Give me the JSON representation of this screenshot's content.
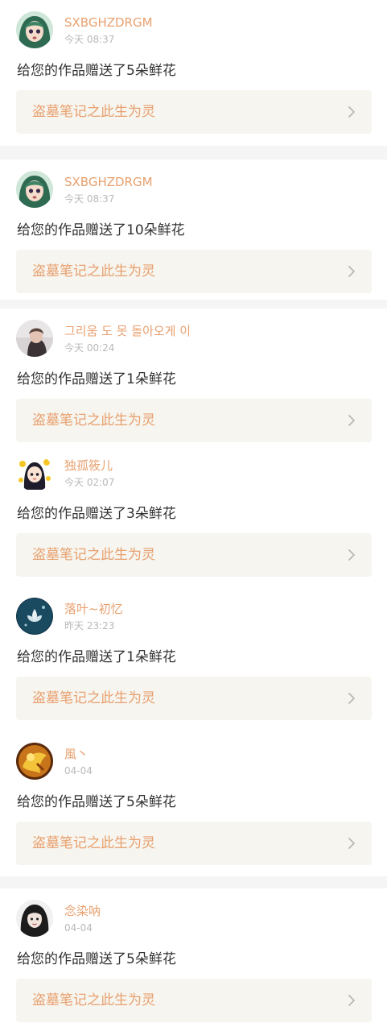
{
  "notifications": [
    {
      "username": "SXBGHZDRGM",
      "time": "今天 08:37",
      "message": "给您的作品赠送了5朵鲜花",
      "work_title": "盗墓笔记之此生为灵",
      "avatar": "avatar-green-hair-girl"
    },
    {
      "username": "SXBGHZDRGM",
      "time": "今天 08:37",
      "message": "给您的作品赠送了10朵鲜花",
      "work_title": "盗墓笔记之此生为灵",
      "avatar": "avatar-green-hair-girl"
    },
    {
      "username": "그리움 도 못 돌아오게 이",
      "time": "今天 00:24",
      "message": "给您的作品赠送了1朵鲜花",
      "work_title": "盗墓笔记之此生为灵",
      "avatar": "avatar-photo-person"
    },
    {
      "username": "独孤筱儿",
      "time": "今天 02:07",
      "message": "给您的作品赠送了3朵鲜花",
      "work_title": "盗墓笔记之此生为灵",
      "avatar": "avatar-cartoon-girl"
    },
    {
      "username": "落叶~初忆",
      "time": "昨天 23:23",
      "message": "给您的作品赠送了1朵鲜花",
      "work_title": "盗墓笔记之此生为灵",
      "avatar": "avatar-lotus"
    },
    {
      "username": "風丶",
      "time": "04-04",
      "message": "给您的作品赠送了5朵鲜花",
      "work_title": "盗墓笔记之此生为灵",
      "avatar": "avatar-golden-figure"
    },
    {
      "username": "念染呐",
      "time": "04-04",
      "message": "给您的作品赠送了5朵鲜花",
      "work_title": "盗墓笔记之此生为灵",
      "avatar": "avatar-dark-hair-girl"
    }
  ],
  "colors": {
    "accent": "#e8a06f",
    "card_bg": "#f6f5ef",
    "separator": "#f5f5f5"
  }
}
